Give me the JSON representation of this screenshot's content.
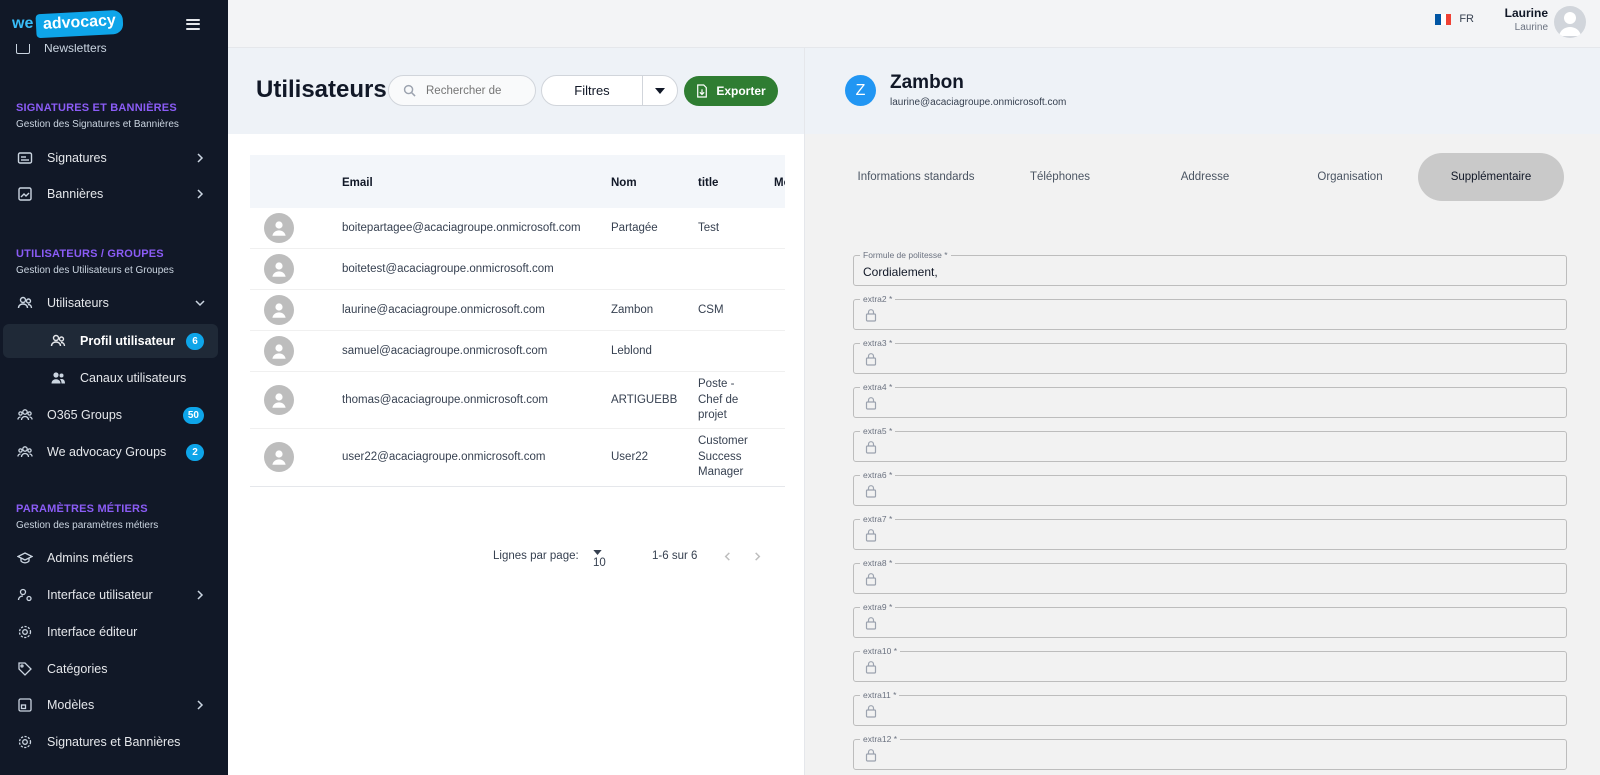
{
  "sidebar": {
    "logo_we": "we",
    "logo_advocacy": "advocacy",
    "cut_item": "Newsletters",
    "sections": [
      {
        "title": "SIGNATURES ET BANNIÈRES",
        "subtitle": "Gestion des Signatures et Bannières"
      },
      {
        "title": "UTILISATEURS / GROUPES",
        "subtitle": "Gestion des Utilisateurs et Groupes"
      },
      {
        "title": "PARAMÈTRES MÉTIERS",
        "subtitle": "Gestion des paramètres métiers"
      }
    ],
    "items": {
      "signatures": "Signatures",
      "bannieres": "Bannières",
      "utilisateurs": "Utilisateurs",
      "profil": "Profil utilisateur",
      "profil_badge": "6",
      "canaux": "Canaux utilisateurs",
      "o365": "O365 Groups",
      "o365_badge": "50",
      "wegroups": "We advocacy Groups",
      "wegroups_badge": "2",
      "admins": "Admins métiers",
      "interface_user": "Interface utilisateur",
      "interface_editor": "Interface éditeur",
      "categories": "Catégories",
      "modeles": "Modèles",
      "sig_ban": "Signatures et Bannières"
    }
  },
  "topbar": {
    "lang": "FR",
    "user_name": "Laurine",
    "user_sub": "Laurine",
    "flag_colors": [
      "#0055a4",
      "#ffffff",
      "#ef4135"
    ]
  },
  "users": {
    "title": "Utilisateurs",
    "search_placeholder": "Rechercher de",
    "filters_label": "Filtres",
    "export_label": "Exporter",
    "columns": {
      "email": "Email",
      "nom": "Nom",
      "title": "title",
      "mobile": "Mob"
    },
    "rows": [
      {
        "email": "boitepartagee@acaciagroupe.onmicrosoft.com",
        "nom": "Partagée",
        "title": "Test"
      },
      {
        "email": "boitetest@acaciagroupe.onmicrosoft.com",
        "nom": "",
        "title": ""
      },
      {
        "email": "laurine@acaciagroupe.onmicrosoft.com",
        "nom": "Zambon",
        "title": "CSM"
      },
      {
        "email": "samuel@acaciagroupe.onmicrosoft.com",
        "nom": "Leblond",
        "title": ""
      },
      {
        "email": "thomas@acaciagroupe.onmicrosoft.com",
        "nom": "ARTIGUEBB",
        "title": "Poste - Chef de projet"
      },
      {
        "email": "user22@acaciagroupe.onmicrosoft.com",
        "nom": "User22",
        "title": "Customer Success Manager"
      }
    ],
    "pager": {
      "rows_label": "Lignes par page:",
      "rows_value": "10",
      "range": "1-6 sur 6"
    }
  },
  "detail": {
    "initial": "Z",
    "name": "Zambon",
    "email": "laurine@acaciagroupe.onmicrosoft.com",
    "tabs": [
      "Informations standards",
      "Téléphones",
      "Addresse",
      "Organisation",
      "Supplémentaire"
    ],
    "active_tab": "Supplémentaire",
    "fields": [
      {
        "label": "Formule de politesse *",
        "value": "Cordialement,",
        "locked": false
      },
      {
        "label": "extra2 *",
        "value": "",
        "locked": true
      },
      {
        "label": "extra3 *",
        "value": "",
        "locked": true
      },
      {
        "label": "extra4 *",
        "value": "",
        "locked": true
      },
      {
        "label": "extra5 *",
        "value": "",
        "locked": true
      },
      {
        "label": "extra6 *",
        "value": "",
        "locked": true
      },
      {
        "label": "extra7 *",
        "value": "",
        "locked": true
      },
      {
        "label": "extra8 *",
        "value": "",
        "locked": true
      },
      {
        "label": "extra9 *",
        "value": "",
        "locked": true
      },
      {
        "label": "extra10 *",
        "value": "",
        "locked": true
      },
      {
        "label": "extra11 *",
        "value": "",
        "locked": true
      },
      {
        "label": "extra12 *",
        "value": "",
        "locked": true
      }
    ]
  },
  "colors": {
    "sidebar_bg": "#111827",
    "accent": "#0ea5e9",
    "section_title": "#8b5cf6",
    "export_green": "#2f7d32"
  }
}
